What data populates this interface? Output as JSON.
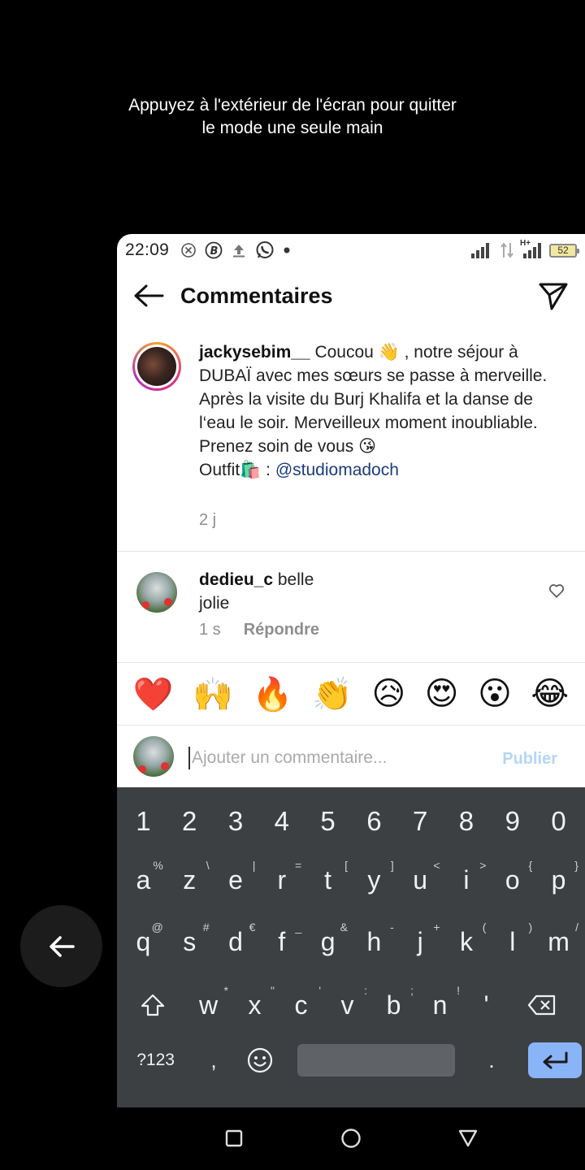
{
  "hint": {
    "line1": "Appuyez à l'extérieur de l'écran pour quitter",
    "line2": "le mode une seule main"
  },
  "status_bar": {
    "time": "22:09",
    "battery": "52",
    "network_type": "H+"
  },
  "header": {
    "title": "Commentaires"
  },
  "caption": {
    "username": "jackysebim__",
    "text": " Coucou 👋 , notre séjour à DUBAÏ avec mes sœurs se passe à merveille. Après la visite du Burj Khalifa et la danse de l‘eau le soir. Merveilleux moment inoubliable. Prenez soin de vous 😘",
    "outfit_label": "Outfit🛍️ : ",
    "mention": "@studiomadoch",
    "age": "2 j"
  },
  "comment": {
    "username": "dedieu_c",
    "text_line1": " belle",
    "text_line2": "jolie",
    "age": "1 s",
    "reply_label": "Répondre"
  },
  "emoji_bar": [
    "❤️",
    "🙌",
    "🔥",
    "👏",
    "😥",
    "😍",
    "😮",
    "😂"
  ],
  "comment_input": {
    "placeholder": "Ajouter un commentaire...",
    "publish_label": "Publier"
  },
  "keyboard": {
    "numbers": [
      "1",
      "2",
      "3",
      "4",
      "5",
      "6",
      "7",
      "8",
      "9",
      "0"
    ],
    "row1": [
      {
        "k": "a",
        "alt": "%"
      },
      {
        "k": "z",
        "alt": "\\"
      },
      {
        "k": "e",
        "alt": "|"
      },
      {
        "k": "r",
        "alt": "="
      },
      {
        "k": "t",
        "alt": "["
      },
      {
        "k": "y",
        "alt": "]"
      },
      {
        "k": "u",
        "alt": "<"
      },
      {
        "k": "i",
        "alt": ">"
      },
      {
        "k": "o",
        "alt": "{"
      },
      {
        "k": "p",
        "alt": "}"
      }
    ],
    "row2": [
      {
        "k": "q",
        "alt": "@"
      },
      {
        "k": "s",
        "alt": "#"
      },
      {
        "k": "d",
        "alt": "€"
      },
      {
        "k": "f",
        "alt": "_"
      },
      {
        "k": "g",
        "alt": "&"
      },
      {
        "k": "h",
        "alt": "-"
      },
      {
        "k": "j",
        "alt": "+"
      },
      {
        "k": "k",
        "alt": "("
      },
      {
        "k": "l",
        "alt": ")"
      },
      {
        "k": "m",
        "alt": "/"
      }
    ],
    "row3": [
      {
        "k": "w",
        "alt": "*"
      },
      {
        "k": "x",
        "alt": "\""
      },
      {
        "k": "c",
        "alt": "'"
      },
      {
        "k": "v",
        "alt": ":"
      },
      {
        "k": "b",
        "alt": ";"
      },
      {
        "k": "n",
        "alt": "!"
      },
      {
        "k": "'",
        "alt": ""
      }
    ],
    "symbols_label": "?123",
    "comma": ",",
    "period": "."
  }
}
